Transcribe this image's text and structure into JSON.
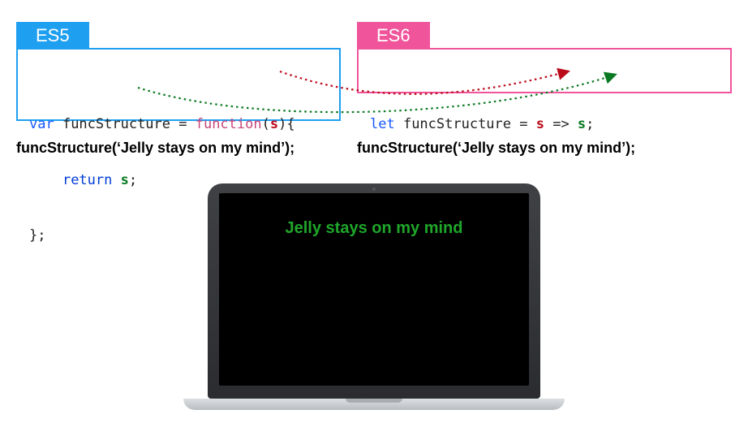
{
  "es5": {
    "tab": "ES5",
    "line1_a": "var",
    "line1_b": " funcStructure = ",
    "line1_c": "function",
    "line1_d": "(",
    "line1_e": "s",
    "line1_f": "){",
    "line2_a": "    ",
    "line2_b": "return",
    "line2_c": " ",
    "line2_d": "s",
    "line2_e": ";",
    "line3": "};",
    "call": "funcStructure(‘Jelly stays on my mind’);"
  },
  "es6": {
    "tab": "ES6",
    "line1_a": "let",
    "line1_b": " funcStructure = ",
    "line1_c": "s",
    "line1_d": " => ",
    "line1_e": "s",
    "line1_f": ";",
    "call": "funcStructure(‘Jelly stays on my mind’);"
  },
  "output": {
    "text": "Jelly stays on my mind"
  },
  "colors": {
    "es5": "#1e9ff0",
    "es6": "#f0549b",
    "param": "#bb0b1a",
    "return": "#0a7a22",
    "screen_text": "#1fa62a"
  }
}
